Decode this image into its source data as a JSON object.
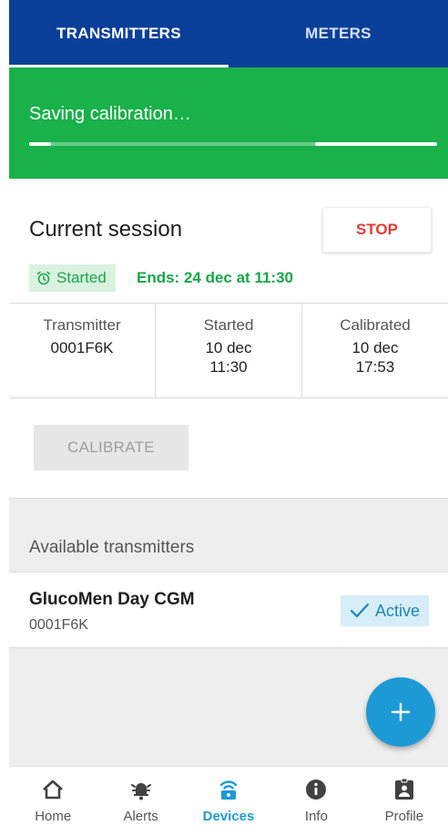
{
  "tabs": [
    {
      "label": "TRANSMITTERS",
      "active": true
    },
    {
      "label": "METERS",
      "active": false
    }
  ],
  "banner": {
    "text": "Saving calibration…"
  },
  "session": {
    "title": "Current session",
    "stop_label": "STOP",
    "status": "Started",
    "ends": "Ends: 24 dec at 11:30",
    "columns": [
      {
        "label": "Transmitter",
        "value1": "0001F6K",
        "value2": ""
      },
      {
        "label": "Started",
        "value1": "10 dec",
        "value2": "11:30"
      },
      {
        "label": "Calibrated",
        "value1": "10 dec",
        "value2": "17:53"
      }
    ],
    "calibrate_label": "CALIBRATE"
  },
  "available": {
    "header": "Available transmitters",
    "items": [
      {
        "name": "GlucoMen Day CGM",
        "id": "0001F6K",
        "status": "Active"
      }
    ]
  },
  "fab": {
    "symbol": "+"
  },
  "nav": [
    {
      "label": "Home",
      "icon": "home-icon"
    },
    {
      "label": "Alerts",
      "icon": "bell-icon"
    },
    {
      "label": "Devices",
      "icon": "transmitter-icon",
      "active": true
    },
    {
      "label": "Info",
      "icon": "info-icon"
    },
    {
      "label": "Profile",
      "icon": "badge-icon"
    }
  ],
  "colors": {
    "header": "#0a3f99",
    "banner": "#19b14a",
    "accent": "#1c9ad6",
    "stop": "#e53935",
    "status_green": "#19a64a"
  }
}
